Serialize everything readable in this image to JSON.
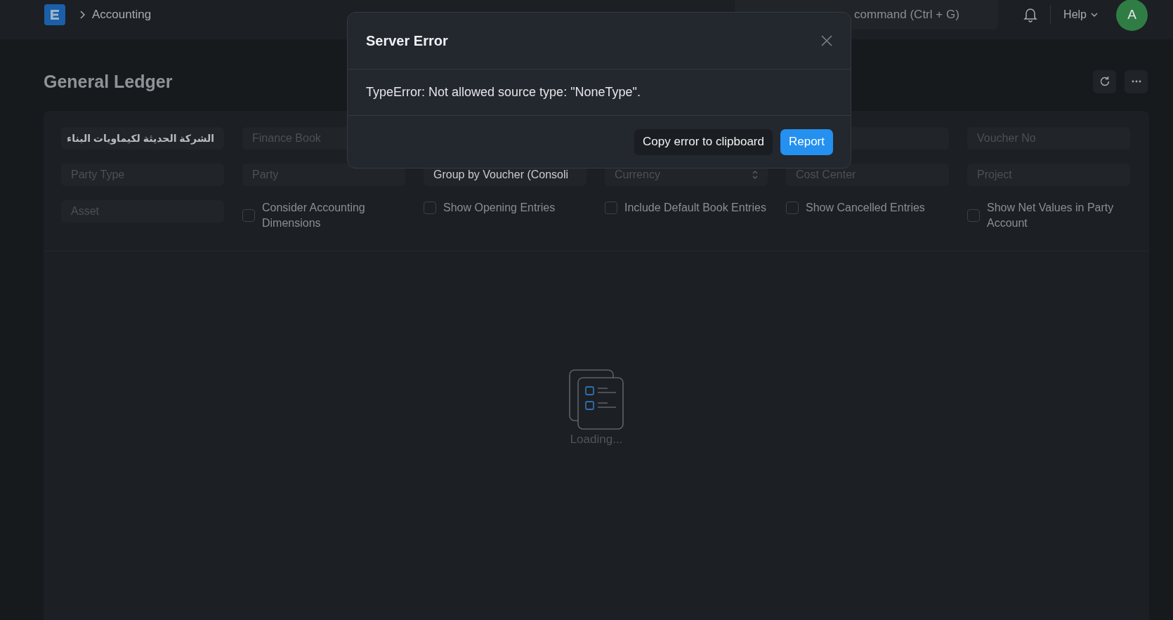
{
  "navbar": {
    "breadcrumb": "Accounting",
    "search": {
      "placeholder": "command (Ctrl + G)"
    },
    "help": "Help",
    "avatar": "A"
  },
  "page": {
    "title": "General Ledger"
  },
  "filters": [
    {
      "kind": "field",
      "value": "الشركة الحديثة لكيماويات البناء"
    },
    {
      "kind": "field",
      "placeholder": "Finance Book"
    },
    {
      "kind": "covered"
    },
    {
      "kind": "covered"
    },
    {
      "kind": "field"
    },
    {
      "kind": "field",
      "placeholder": "Voucher No"
    },
    {
      "kind": "field",
      "placeholder": "Party Type"
    },
    {
      "kind": "field",
      "placeholder": "Party"
    },
    {
      "kind": "select",
      "value": "Group by Voucher (Consoli"
    },
    {
      "kind": "select",
      "placeholder": "Currency"
    },
    {
      "kind": "field",
      "placeholder": "Cost Center"
    },
    {
      "kind": "field",
      "placeholder": "Project"
    },
    {
      "kind": "field",
      "placeholder": "Asset"
    },
    {
      "kind": "checkbox",
      "label": "Consider Accounting Dimensions",
      "checked": false
    },
    {
      "kind": "checkbox",
      "label": "Show Opening Entries",
      "checked": false
    },
    {
      "kind": "checkbox",
      "label": "Include Default Book Entries",
      "checked": false
    },
    {
      "kind": "checkbox",
      "label": "Show Cancelled Entries",
      "checked": false
    },
    {
      "kind": "checkbox",
      "label": "Show Net Values in Party Account",
      "checked": false
    }
  ],
  "loading": "Loading...",
  "dialog": {
    "title": "Server Error",
    "message": "TypeError: Not allowed source type: \"NoneType\".",
    "buttons": [
      {
        "label": "Copy error to clipboard",
        "kind": "secondary"
      },
      {
        "label": "Report",
        "kind": "primary"
      }
    ]
  }
}
